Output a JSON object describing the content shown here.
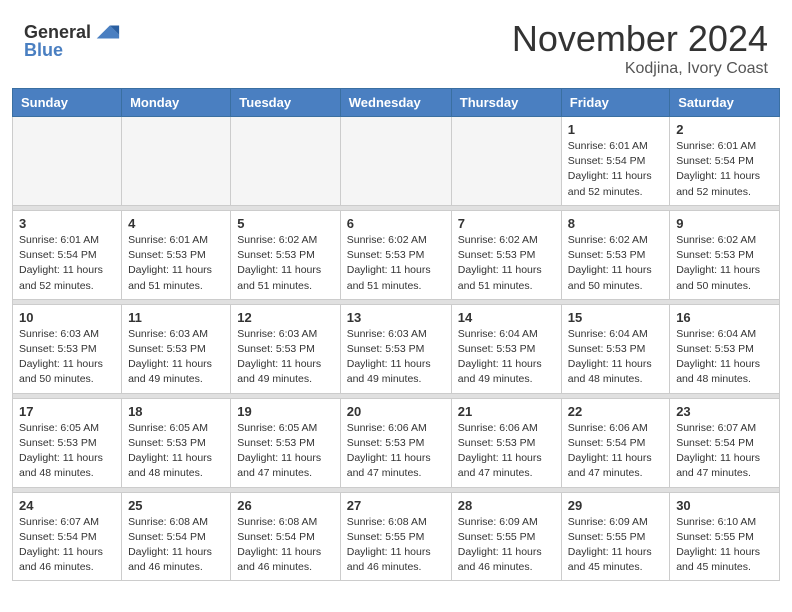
{
  "header": {
    "logo_general": "General",
    "logo_blue": "Blue",
    "month": "November 2024",
    "location": "Kodjina, Ivory Coast"
  },
  "weekdays": [
    "Sunday",
    "Monday",
    "Tuesday",
    "Wednesday",
    "Thursday",
    "Friday",
    "Saturday"
  ],
  "weeks": [
    [
      {
        "day": "",
        "info": ""
      },
      {
        "day": "",
        "info": ""
      },
      {
        "day": "",
        "info": ""
      },
      {
        "day": "",
        "info": ""
      },
      {
        "day": "",
        "info": ""
      },
      {
        "day": "1",
        "info": "Sunrise: 6:01 AM\nSunset: 5:54 PM\nDaylight: 11 hours\nand 52 minutes."
      },
      {
        "day": "2",
        "info": "Sunrise: 6:01 AM\nSunset: 5:54 PM\nDaylight: 11 hours\nand 52 minutes."
      }
    ],
    [
      {
        "day": "3",
        "info": "Sunrise: 6:01 AM\nSunset: 5:54 PM\nDaylight: 11 hours\nand 52 minutes."
      },
      {
        "day": "4",
        "info": "Sunrise: 6:01 AM\nSunset: 5:53 PM\nDaylight: 11 hours\nand 51 minutes."
      },
      {
        "day": "5",
        "info": "Sunrise: 6:02 AM\nSunset: 5:53 PM\nDaylight: 11 hours\nand 51 minutes."
      },
      {
        "day": "6",
        "info": "Sunrise: 6:02 AM\nSunset: 5:53 PM\nDaylight: 11 hours\nand 51 minutes."
      },
      {
        "day": "7",
        "info": "Sunrise: 6:02 AM\nSunset: 5:53 PM\nDaylight: 11 hours\nand 51 minutes."
      },
      {
        "day": "8",
        "info": "Sunrise: 6:02 AM\nSunset: 5:53 PM\nDaylight: 11 hours\nand 50 minutes."
      },
      {
        "day": "9",
        "info": "Sunrise: 6:02 AM\nSunset: 5:53 PM\nDaylight: 11 hours\nand 50 minutes."
      }
    ],
    [
      {
        "day": "10",
        "info": "Sunrise: 6:03 AM\nSunset: 5:53 PM\nDaylight: 11 hours\nand 50 minutes."
      },
      {
        "day": "11",
        "info": "Sunrise: 6:03 AM\nSunset: 5:53 PM\nDaylight: 11 hours\nand 49 minutes."
      },
      {
        "day": "12",
        "info": "Sunrise: 6:03 AM\nSunset: 5:53 PM\nDaylight: 11 hours\nand 49 minutes."
      },
      {
        "day": "13",
        "info": "Sunrise: 6:03 AM\nSunset: 5:53 PM\nDaylight: 11 hours\nand 49 minutes."
      },
      {
        "day": "14",
        "info": "Sunrise: 6:04 AM\nSunset: 5:53 PM\nDaylight: 11 hours\nand 49 minutes."
      },
      {
        "day": "15",
        "info": "Sunrise: 6:04 AM\nSunset: 5:53 PM\nDaylight: 11 hours\nand 48 minutes."
      },
      {
        "day": "16",
        "info": "Sunrise: 6:04 AM\nSunset: 5:53 PM\nDaylight: 11 hours\nand 48 minutes."
      }
    ],
    [
      {
        "day": "17",
        "info": "Sunrise: 6:05 AM\nSunset: 5:53 PM\nDaylight: 11 hours\nand 48 minutes."
      },
      {
        "day": "18",
        "info": "Sunrise: 6:05 AM\nSunset: 5:53 PM\nDaylight: 11 hours\nand 48 minutes."
      },
      {
        "day": "19",
        "info": "Sunrise: 6:05 AM\nSunset: 5:53 PM\nDaylight: 11 hours\nand 47 minutes."
      },
      {
        "day": "20",
        "info": "Sunrise: 6:06 AM\nSunset: 5:53 PM\nDaylight: 11 hours\nand 47 minutes."
      },
      {
        "day": "21",
        "info": "Sunrise: 6:06 AM\nSunset: 5:53 PM\nDaylight: 11 hours\nand 47 minutes."
      },
      {
        "day": "22",
        "info": "Sunrise: 6:06 AM\nSunset: 5:54 PM\nDaylight: 11 hours\nand 47 minutes."
      },
      {
        "day": "23",
        "info": "Sunrise: 6:07 AM\nSunset: 5:54 PM\nDaylight: 11 hours\nand 47 minutes."
      }
    ],
    [
      {
        "day": "24",
        "info": "Sunrise: 6:07 AM\nSunset: 5:54 PM\nDaylight: 11 hours\nand 46 minutes."
      },
      {
        "day": "25",
        "info": "Sunrise: 6:08 AM\nSunset: 5:54 PM\nDaylight: 11 hours\nand 46 minutes."
      },
      {
        "day": "26",
        "info": "Sunrise: 6:08 AM\nSunset: 5:54 PM\nDaylight: 11 hours\nand 46 minutes."
      },
      {
        "day": "27",
        "info": "Sunrise: 6:08 AM\nSunset: 5:55 PM\nDaylight: 11 hours\nand 46 minutes."
      },
      {
        "day": "28",
        "info": "Sunrise: 6:09 AM\nSunset: 5:55 PM\nDaylight: 11 hours\nand 46 minutes."
      },
      {
        "day": "29",
        "info": "Sunrise: 6:09 AM\nSunset: 5:55 PM\nDaylight: 11 hours\nand 45 minutes."
      },
      {
        "day": "30",
        "info": "Sunrise: 6:10 AM\nSunset: 5:55 PM\nDaylight: 11 hours\nand 45 minutes."
      }
    ]
  ]
}
